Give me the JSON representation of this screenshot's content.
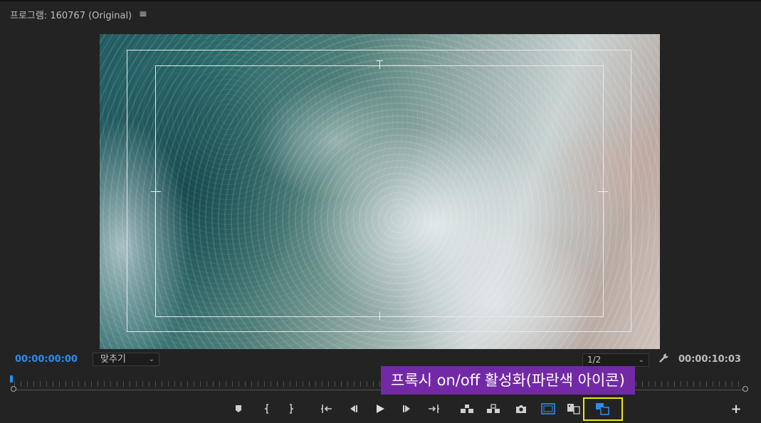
{
  "panel": {
    "title": "프로그램: 160767 (Original)",
    "menu_glyph": "≡"
  },
  "status": {
    "current_timecode": "00:00:00:00",
    "zoom_value": "맞추기",
    "resolution_value": "1/2",
    "duration_timecode": "00:00:10:03"
  },
  "callout": {
    "text": "프록시 on/off 활성화(파란색 아이콘)"
  },
  "transport": {
    "add_glyph": "+"
  },
  "colors": {
    "accent_blue": "#2d8ceb",
    "highlight_yellow": "#f4e312",
    "callout_purple": "#7229a6"
  },
  "icons": [
    "marker-icon",
    "mark-in-icon",
    "mark-out-icon",
    "go-to-in-icon",
    "step-back-icon",
    "play-icon",
    "step-forward-icon",
    "go-to-out-icon",
    "lift-icon",
    "extract-icon",
    "export-frame-icon",
    "safe-margins-icon",
    "comparison-view-icon",
    "toggle-proxies-icon",
    "add-button-icon",
    "wrench-icon"
  ]
}
